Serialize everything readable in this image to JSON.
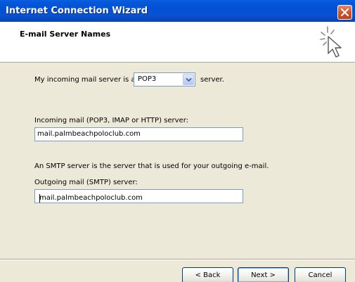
{
  "window": {
    "title": "Internet Connection Wizard"
  },
  "header": {
    "title": "E-mail Server Names",
    "icon": "wizard-cursor-icon"
  },
  "form": {
    "incoming_prefix": "My incoming mail server is a",
    "server_type": {
      "selected": "POP3"
    },
    "incoming_suffix": "server.",
    "incoming_label": "Incoming mail (POP3, IMAP or HTTP) server:",
    "incoming_value": "mail.palmbeachpoloclub.com",
    "smtp_note": "An SMTP server is the server that is used for your outgoing e-mail.",
    "outgoing_label": "Outgoing mail (SMTP) server:",
    "outgoing_value": "mail.palmbeachpoloclub.com"
  },
  "buttons": {
    "back": "< Back",
    "next": "Next >",
    "cancel": "Cancel"
  },
  "colors": {
    "titlebar": "#0051d6",
    "dialog_bg": "#ece9d8",
    "close": "#d5552e",
    "field_border": "#7f9db9"
  }
}
